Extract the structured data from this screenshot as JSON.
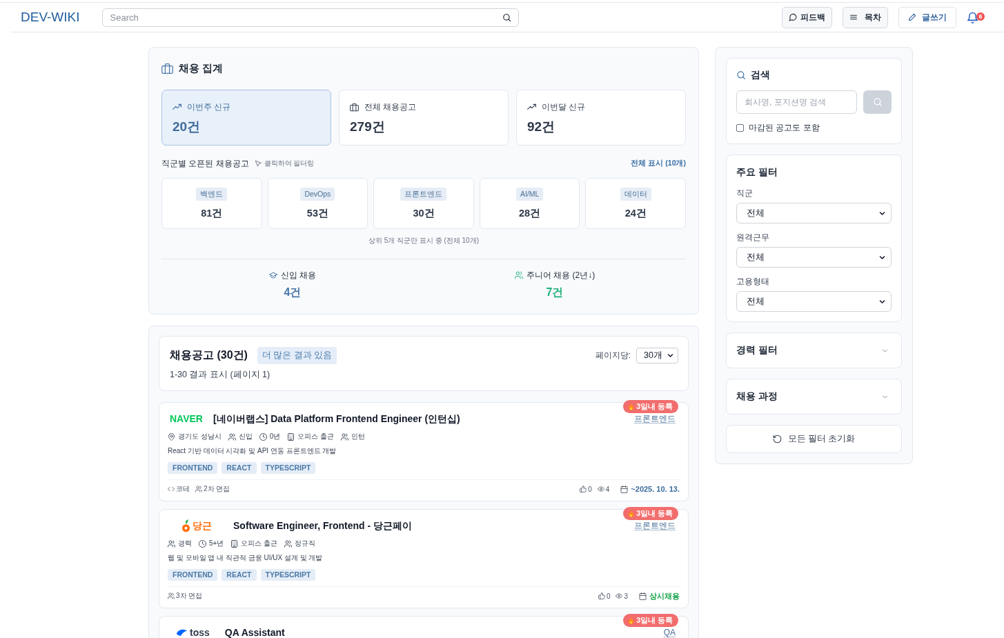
{
  "header": {
    "logo": "DEV-WIKI",
    "search": {
      "placeholder": "Search"
    },
    "buttons": [
      {
        "label": "피드백",
        "kind": "feedback"
      },
      {
        "label": "목차",
        "kind": "toc"
      },
      {
        "label": "글쓰기",
        "kind": "write"
      }
    ],
    "notifications": "6"
  },
  "stats": {
    "title": "채용 집계",
    "cards": [
      {
        "kind": "new",
        "label": "이번주 신규",
        "value": "20건",
        "selected": true
      },
      {
        "kind": "total",
        "label": "전체 채용공고",
        "value": "279건",
        "selected": false
      },
      {
        "kind": "new",
        "label": "이번달 신규",
        "value": "92건",
        "selected": false
      }
    ],
    "categories_title": "직군별 오픈된 채용공고",
    "categories_hint": "클릭하여 필터링",
    "show_all": "전체 표시 (10개)",
    "categories": [
      {
        "name": "백엔드",
        "count": "81건"
      },
      {
        "name": "DevOps",
        "count": "53건"
      },
      {
        "name": "프론트엔드",
        "count": "30건"
      },
      {
        "name": "AI/ML",
        "count": "28건"
      },
      {
        "name": "데이터",
        "count": "24건"
      }
    ],
    "categories_note": "상위 5개 직군만 표시 중 (전체 10개)",
    "highlights": [
      {
        "kind": "entry",
        "label": "신입 채용",
        "value": "4건",
        "color": "#4a78a8"
      },
      {
        "kind": "junior",
        "label": "주니어 채용 (2년↓)",
        "value": "7건",
        "color": "#20b07a"
      }
    ]
  },
  "jobs": {
    "title": "채용공고 (30건)",
    "more_badge": "더 많은 결과 있음",
    "summary": "1-30 결과 표시 (페이지 1)",
    "per_page_label": "페이지당:",
    "per_page": "30개",
    "items": [
      {
        "logo": {
          "kind": "plain",
          "text": "NAVER",
          "color": "#03c75a"
        },
        "title": "[네이버랩스] Data Platform Frontend Engineer (인턴십)",
        "badge": "3일내 등록",
        "category": "프론트엔드",
        "meta": [
          {
            "kind": "location",
            "text": "경기도 성남시"
          },
          {
            "kind": "career",
            "text": "신입"
          },
          {
            "kind": "years",
            "text": "0년"
          },
          {
            "kind": "office",
            "text": "오피스 출근"
          },
          {
            "kind": "employment",
            "text": "인턴"
          }
        ],
        "description": "React 기반 데이터 시각화 및 API 연동 프론트엔드 개발",
        "tags": [
          "FRONTEND",
          "REACT",
          "TYPESCRIPT"
        ],
        "process": [
          {
            "kind": "coding_test",
            "text": "코테"
          },
          {
            "kind": "interview",
            "text": "2차 면접"
          }
        ],
        "likes": "0",
        "views": "4",
        "deadline": {
          "text": "~2025. 10. 13.",
          "color": "#3d6d9e"
        }
      },
      {
        "logo": {
          "kind": "carrot",
          "text": "당근",
          "color": "#ff6f0f"
        },
        "title": "Software Engineer, Frontend - 당근페이",
        "badge": "3일내 등록",
        "category": "프론트엔드",
        "meta": [
          {
            "kind": "career",
            "text": "경력"
          },
          {
            "kind": "years",
            "text": "5+년"
          },
          {
            "kind": "office",
            "text": "오피스 출근"
          },
          {
            "kind": "employment",
            "text": "정규직"
          }
        ],
        "description": "웹 및 모바일 앱 내 직관적 금융 UI/UX 설계 및 개발",
        "tags": [
          "FRONTEND",
          "REACT",
          "TYPESCRIPT"
        ],
        "process": [
          {
            "kind": "interview",
            "text": "3차 면접"
          }
        ],
        "likes": "0",
        "views": "3",
        "deadline": {
          "text": "상시채용",
          "color": "#16a34a"
        }
      },
      {
        "logo": {
          "kind": "swoosh",
          "text": "toss",
          "color": "#333d4b"
        },
        "title": "QA Assistant",
        "badge": "3일내 등록",
        "category": "QA"
      }
    ]
  },
  "filters": {
    "search": {
      "title": "검색",
      "placeholder": "회사명, 포지션명 검색",
      "button_disabled": true,
      "include_closed": {
        "label": "마감된 공고도 포함",
        "checked": false
      }
    },
    "main": {
      "title": "주요 필터",
      "selects": [
        {
          "label": "직군",
          "value": "전체"
        },
        {
          "label": "원격근무",
          "value": "전체"
        },
        {
          "label": "고용형태",
          "value": "전체"
        }
      ]
    },
    "sections": [
      {
        "title": "경력 필터",
        "expanded": false
      },
      {
        "title": "채용 과정",
        "expanded": false
      }
    ],
    "reset": "모든 필터 초기화"
  }
}
